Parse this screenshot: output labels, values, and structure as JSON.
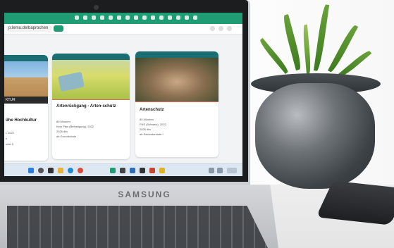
{
  "device": {
    "brand": "SAMSUNG"
  },
  "browser": {
    "url": "p.lemu.de/baprochen"
  },
  "cards": [
    {
      "title": "ühe Hochkultur",
      "tag": "KTUR",
      "meta": [
        "l, 2022",
        "e",
        "nulé 5"
      ]
    },
    {
      "title": "Artenrückgang - Arten-schutz",
      "meta": [
        "80 Minuten",
        "Kein Plan (Befestigung), 2022",
        "2026 dkv",
        "ab Grundschule"
      ]
    },
    {
      "title": "Artenschutz",
      "meta": [
        "80 Minuten",
        "FNS (Schweiz), 2022",
        "2026 dkv",
        "ab Sekundarstufe I"
      ]
    }
  ],
  "colors": {
    "accent": "#1f9c74",
    "card_header": "#1a6d73",
    "separator": "#e26a5a"
  }
}
